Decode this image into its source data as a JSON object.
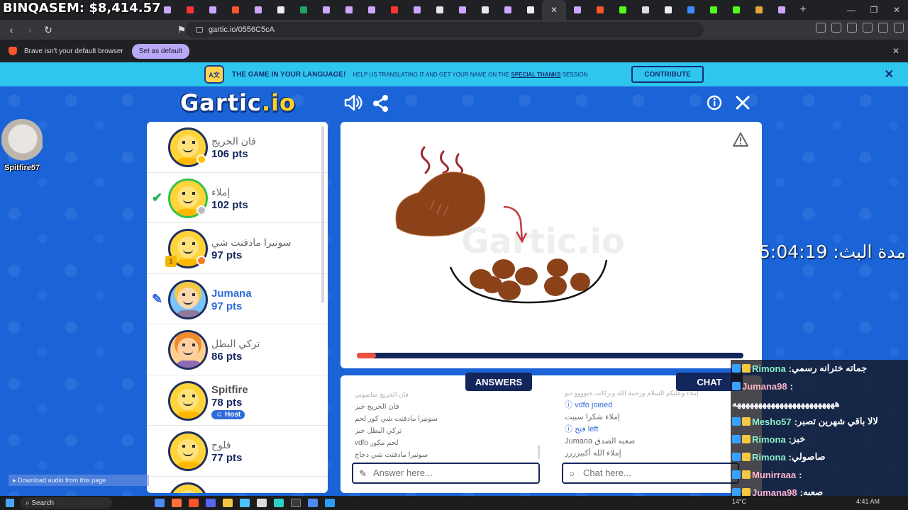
{
  "stream": {
    "title": "BINQASEM: $8,414.57",
    "cam_label": "Spitfire57",
    "timer": "مدة البث: 5:04:19",
    "download_audio": "Download audio from this page"
  },
  "browser": {
    "url": "gartic.io/0556C5cA",
    "default_msg": "Brave isn't your default browser",
    "set_default": "Set as default"
  },
  "banner": {
    "title": "THE GAME IN YOUR LANGUAGE!",
    "text_before": "HELP US TRANSLATING IT AND GET YOUR NAME ON THE",
    "link": "SPECIAL THANKS",
    "text_after": "SESSION",
    "button": "CONTRIBUTE"
  },
  "game": {
    "logo_main": "Gartic",
    "logo_suffix": ".io",
    "timer_progress": 0.05
  },
  "players": [
    {
      "name": "فان الخريج",
      "points": "106 pts"
    },
    {
      "name": "إملاء",
      "points": "102 pts"
    },
    {
      "name": "سونيرا مادفنت شي",
      "points": "97 pts"
    },
    {
      "name": "Jumana",
      "points": "97 pts"
    },
    {
      "name": "تركي البطل",
      "points": "86 pts"
    },
    {
      "name": "Spitfire",
      "points": "78 pts",
      "tag": "Host"
    },
    {
      "name": "فلوح",
      "points": "77 pts"
    }
  ],
  "answers": {
    "tab": "ANSWERS",
    "items": [
      "فان الخريج صاصوني",
      "فان الخريج خبز",
      "سونيرا مادفنت شي كور لحم",
      "تركي البطل خبز",
      "vdfo لحم مكور",
      "سونيرا مادفنت شي دجاج"
    ],
    "placeholder": "Answer here..."
  },
  "chat": {
    "tab": "CHAT",
    "items": [
      "إملاء وعليكم السلام ورحمة الله وبركاته، خيوووو دبو",
      "vdfo joined",
      "إملاء شكرا سبيت",
      "فتح left",
      "Jumana صعبه الصدق",
      "إملاء الله أكبيرررر"
    ],
    "placeholder": "Chat here..."
  },
  "stream_chat": [
    {
      "user": "Rimona",
      "msg": "جماته خترانه رسمي"
    },
    {
      "user": "Jumana98",
      "msg": ""
    },
    {
      "user": "",
      "msg": "ههههههههههههههههههههههههه"
    },
    {
      "user": "Mesho57",
      "msg": "لالا باقي شهرين تصبر"
    },
    {
      "user": "Rimona",
      "msg": "خبز"
    },
    {
      "user": "Rimona",
      "msg": "صاصولي"
    },
    {
      "user": "Munirraaa",
      "msg": ""
    },
    {
      "user": "Jumana98",
      "msg": "صعبه"
    }
  ],
  "taskbar": {
    "search": "Search",
    "time": "4:41 AM",
    "weather": "14°C"
  },
  "colors": {
    "page_bg": "#1b64d8",
    "banner": "#2ec6ef",
    "navy": "#14275c",
    "accent_blue": "#2f6ad8",
    "progress": "#e8523f"
  }
}
